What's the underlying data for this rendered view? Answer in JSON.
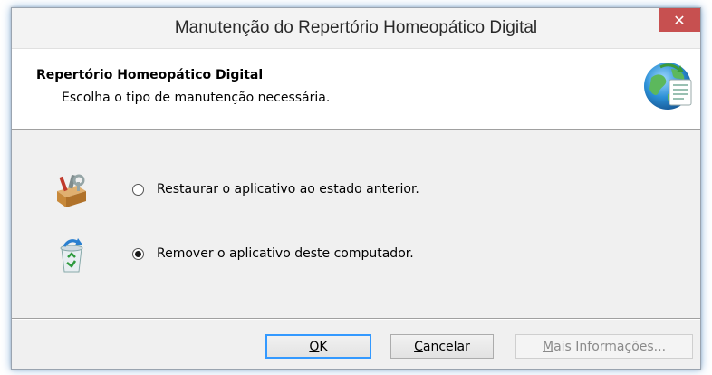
{
  "window": {
    "title": "Manutenção do Repertório Homeopático Digital",
    "close_symbol": "✕"
  },
  "header": {
    "title": "Repertório Homeopático Digital",
    "subtitle": "Escolha o tipo de manutenção necessária.",
    "icon": "globe-document-icon"
  },
  "options": [
    {
      "label": "Restaurar o aplicativo ao estado anterior.",
      "selected": false,
      "icon": "toolbox-icon"
    },
    {
      "label": "Remover o aplicativo deste computador.",
      "selected": true,
      "icon": "recycle-bin-icon"
    }
  ],
  "buttons": {
    "ok": {
      "mnemonic": "O",
      "rest": "K"
    },
    "cancel": {
      "mnemonic": "C",
      "rest": "ancelar"
    },
    "more": {
      "mnemonic": "M",
      "rest": "ais Informações..."
    }
  },
  "colors": {
    "close_button": "#c75050",
    "focus_border": "#3399ff",
    "dialog_background": "#f0f0f0"
  }
}
